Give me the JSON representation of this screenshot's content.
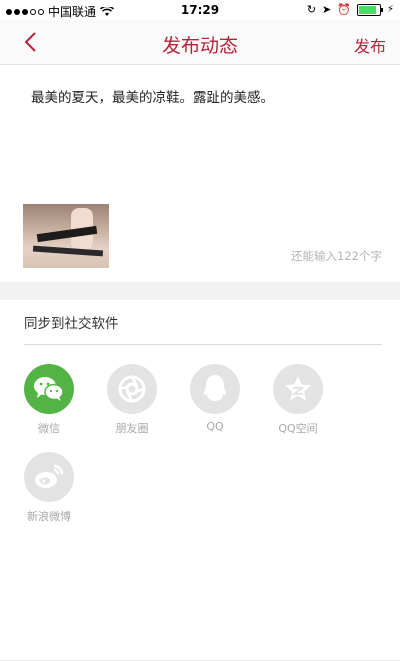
{
  "status_bar": {
    "carrier": "中国联通",
    "time": "17:29",
    "battery_level": 0.85,
    "battery_color": "#4cd964"
  },
  "nav": {
    "back_icon": "chevron-left-icon",
    "title": "发布动态",
    "action": "发布",
    "accent_color": "#b5243a"
  },
  "post": {
    "text": "最美的夏天，最美的凉鞋。露趾的美感。",
    "remaining": "还能输入122个字"
  },
  "sync": {
    "title": "同步到社交软件",
    "items": [
      {
        "label": "微信",
        "icon": "wechat-icon",
        "active": true
      },
      {
        "label": "朋友圈",
        "icon": "moments-icon",
        "active": false
      },
      {
        "label": "QQ",
        "icon": "qq-icon",
        "active": false
      },
      {
        "label": "QQ空间",
        "icon": "qzone-icon",
        "active": false
      },
      {
        "label": "新浪微博",
        "icon": "weibo-icon",
        "active": false
      }
    ]
  }
}
